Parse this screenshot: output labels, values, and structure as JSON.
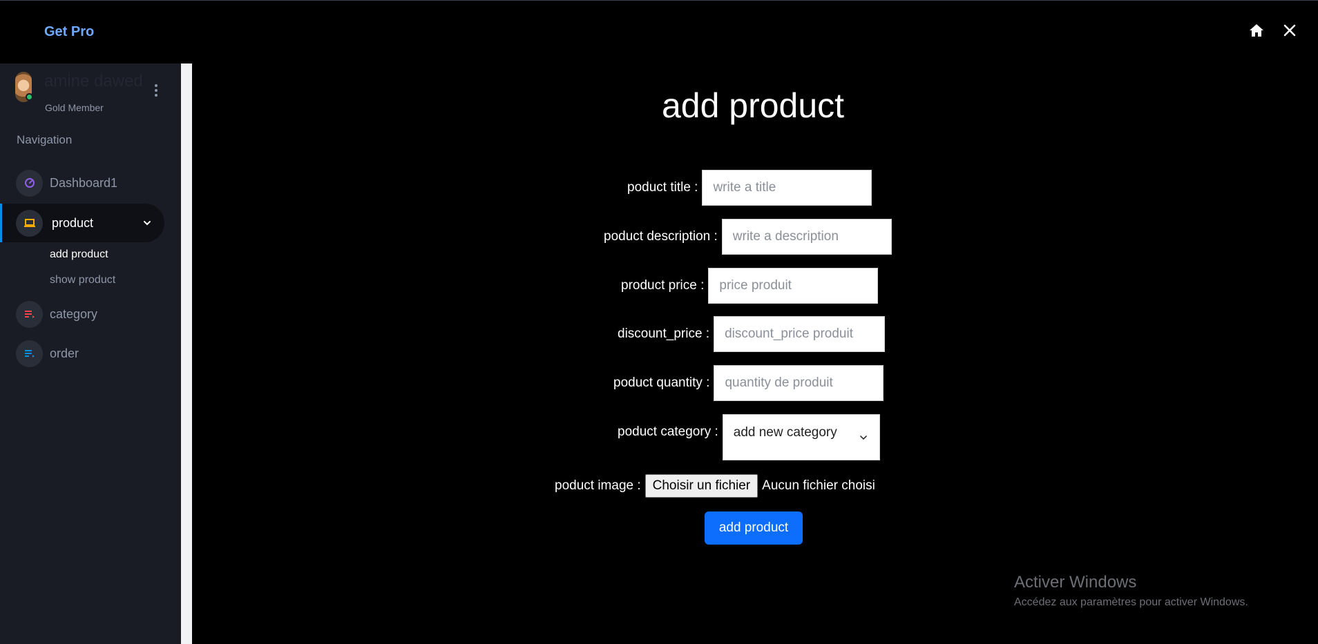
{
  "header": {
    "brand": "Get Pro",
    "icons": [
      "home-icon",
      "close-icon"
    ]
  },
  "sidebar": {
    "profile": {
      "name": "amine dawed",
      "rank": "Gold Member",
      "status_color": "#2bbf6a"
    },
    "heading": "Navigation",
    "items": [
      {
        "label": "Dashboard1",
        "icon": "speedometer-icon",
        "icon_color": "#8f5fe8"
      },
      {
        "label": "product",
        "icon": "laptop-icon",
        "icon_color": "#ffab00",
        "active": true,
        "sub": [
          {
            "label": "add product",
            "current": true
          },
          {
            "label": "show product"
          }
        ]
      },
      {
        "label": "category",
        "icon": "playlist-icon",
        "icon_color": "#fc424a"
      },
      {
        "label": "order",
        "icon": "playlist-icon",
        "icon_color": "#0090e7"
      }
    ]
  },
  "main": {
    "title": "add product",
    "fields": {
      "title_label": "poduct title :",
      "title_placeholder": "write a title",
      "description_label": "poduct description :",
      "description_placeholder": "write a description",
      "price_label": "product price :",
      "price_placeholder": "price produit",
      "discount_label": "discount_price :",
      "discount_placeholder": "discount_price produit",
      "quantity_label": "poduct quantity :",
      "quantity_placeholder": "quantity de produit",
      "category_label": "poduct category :",
      "category_value": "add new category",
      "image_label": "poduct image :",
      "image_button": "Choisir un fichier",
      "image_status": "Aucun fichier choisi"
    },
    "submit_label": "add product",
    "accent_color": "#0d6efd"
  },
  "watermark": {
    "line1": "Activer Windows",
    "line2": "Accédez aux paramètres pour activer Windows."
  }
}
